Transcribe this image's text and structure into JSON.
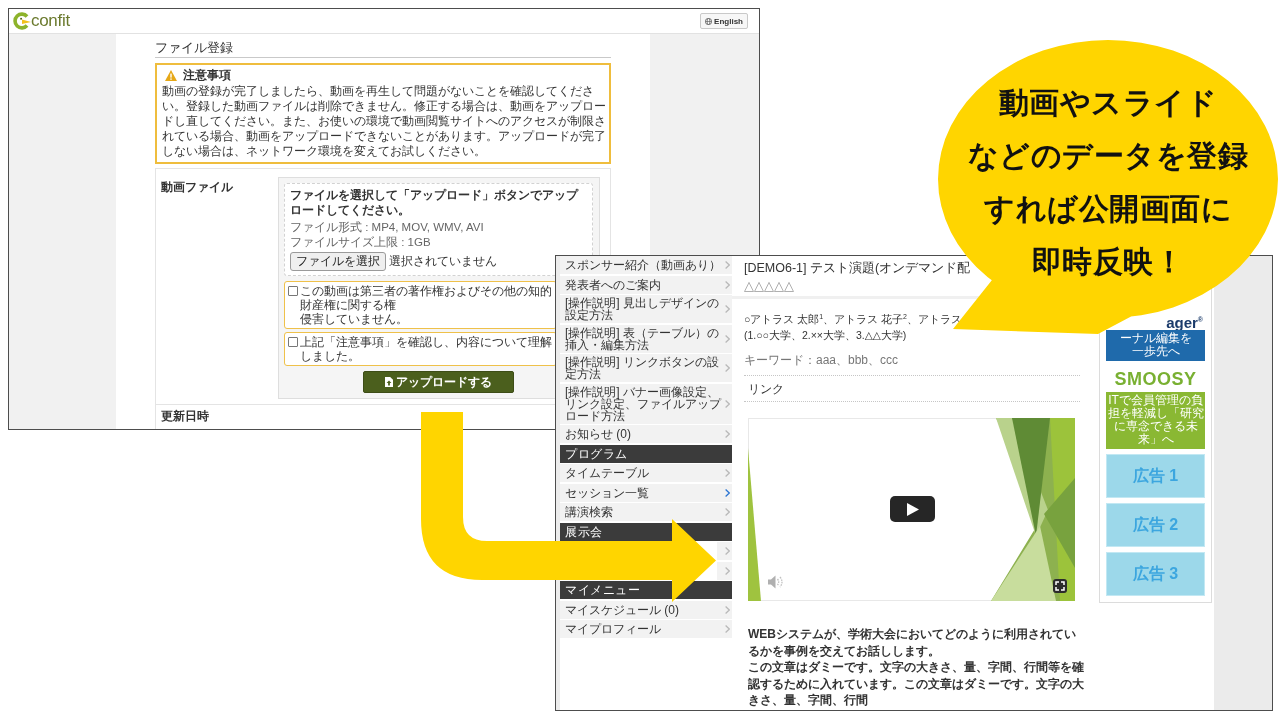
{
  "back_window": {
    "header": {
      "logo": "confit",
      "language_button": "English"
    },
    "page_title": "ファイル登録",
    "notice": {
      "title": "注意事項",
      "text": "動画の登録が完了しましたら、動画を再生して問題がないことを確認してください。登録した動画ファイルは削除できません。修正する場合は、動画をアップロードし直してください。また、お使いの環境で動画閲覧サイトへのアクセスが制限されている場合、動画をアップロードできないことがあります。アップロードが完了しない場合は、ネットワーク環境を変えてお試しください。"
    },
    "form": {
      "label": "動画ファイル",
      "instruction": "ファイルを選択して「アップロード」ボタンでアップロードしてください。",
      "file_info": [
        "ファイル形式 : MP4, MOV, WMV, AVI",
        "ファイルサイズ上限 : 1GB"
      ],
      "file_button": "ファイルを選択",
      "file_status": "選択されていません",
      "agreements": [
        {
          "lines": [
            "この動画は第三者の著作権およびその他の知的財産権に関する権",
            "侵害していません。"
          ],
          "checked": false
        },
        {
          "lines": [
            "上記「注意事項」を確認し、内容について理解しました。"
          ],
          "checked": false
        }
      ],
      "upload_button": "アップロードする"
    },
    "next_section_label": "更新日時"
  },
  "front_window": {
    "sidebar": [
      {
        "kind": "item",
        "label": "スポンサー紹介（動画あり）",
        "selected": false
      },
      {
        "kind": "item",
        "label": "発表者へのご案内",
        "selected": false
      },
      {
        "kind": "item",
        "label": "[操作説明] 見出しデザインの設定方法",
        "selected": false
      },
      {
        "kind": "item",
        "label": "[操作説明] 表（テーブル）の挿入・編集方法",
        "selected": false
      },
      {
        "kind": "item",
        "label": "[操作説明] リンクボタンの設定方法",
        "selected": false
      },
      {
        "kind": "item",
        "label": "[操作説明] バナー画像設定、リンク設定、ファイルアップロード方法",
        "selected": false
      },
      {
        "kind": "item",
        "label": "お知らせ (0)",
        "selected": false
      },
      {
        "kind": "heading",
        "label": "プログラム"
      },
      {
        "kind": "item",
        "label": "タイムテーブル",
        "selected": false
      },
      {
        "kind": "item",
        "label": "セッション一覧",
        "selected": true
      },
      {
        "kind": "item",
        "label": "講演検索",
        "selected": false
      },
      {
        "kind": "heading",
        "label": "展示会"
      },
      {
        "kind": "item",
        "selected": false
      },
      {
        "kind": "item",
        "selected": false
      },
      {
        "kind": "heading",
        "label": "マイメニュー"
      },
      {
        "kind": "item",
        "label": "マイスケジュール (0)",
        "selected": false
      },
      {
        "kind": "item",
        "label": "マイプロフィール",
        "selected": false
      }
    ],
    "title": "[DEMO6-1] テスト演題(オンデマンド配",
    "title_continued": "△△△△△",
    "authors": "○アトラス 太郎$^{1}$、アトラス 花子$^{2}$、アトラス",
    "affiliations": "(1.○○大学、2.××大学、3.△△大学)",
    "keywords": "キーワード：aaa、bbb、ccc",
    "links_heading": "リンク",
    "body": [
      "WEBシステムが、学術大会においてどのように利用されているかを事例を交えてお話しします。",
      "この文章はダミーです。文字の大きさ、量、字間、行間等を確認するために入れています。この文章はダミーです。文字の大きさ、量、字間、行間"
    ],
    "banners": [
      {
        "kind": "journal",
        "logo": "ager$^{®}$",
        "caption": "ーナル編集を一歩先へ"
      },
      {
        "kind": "membership",
        "logo": "SMOOSY",
        "caption": "ITで会員管理の負担を軽減し「研究に専念できる未来」へ"
      }
    ],
    "ads": [
      "広告 1",
      "広告 2",
      "広告 3"
    ]
  },
  "callout": {
    "lines": [
      "動画やスライド",
      "などのデータを登録",
      "すれば公開画面に",
      "即時反映！"
    ]
  }
}
